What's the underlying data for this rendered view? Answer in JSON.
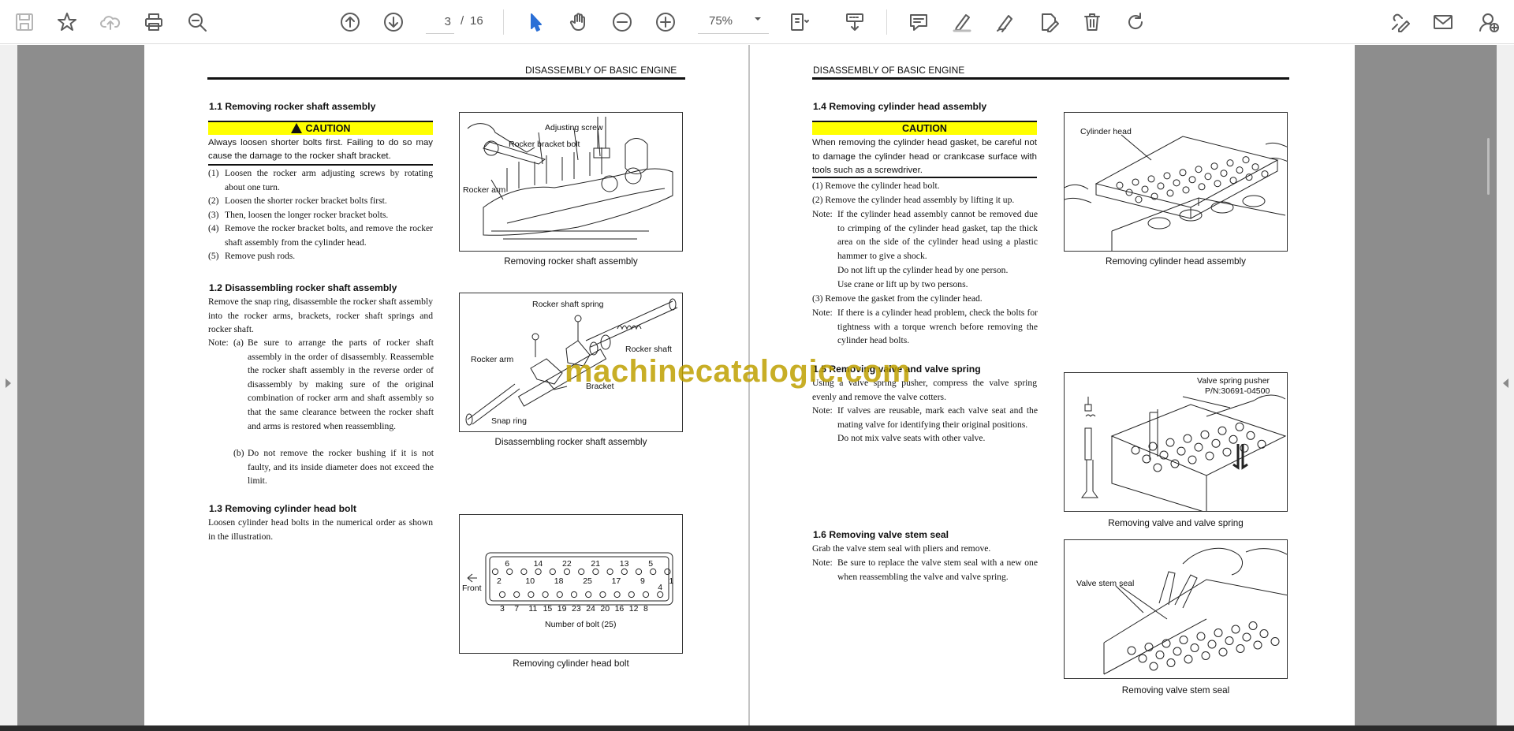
{
  "toolbar": {
    "page_current": "3",
    "page_sep": "/",
    "page_total": "16",
    "zoom": "75%"
  },
  "watermark": "machinecatalogic.com",
  "left_page": {
    "running_head": "DISASSEMBLY OF BASIC ENGINE",
    "s11": {
      "title": "1.1   Removing rocker shaft assembly",
      "caution": "CAUTION",
      "caution_text": "Always loosen shorter bolts first. Failing to do so may cause the damage to the rocker shaft bracket.",
      "steps": [
        {
          "n": "(1)",
          "t": "Loosen the rocker arm adjusting screws by rotating about one turn."
        },
        {
          "n": "(2)",
          "t": "Loosen the shorter rocker bracket bolts first."
        },
        {
          "n": "(3)",
          "t": "Then, loosen the longer rocker bracket bolts."
        },
        {
          "n": "(4)",
          "t": "Remove the rocker bracket bolts, and remove the rocker shaft assembly from the cylinder head."
        },
        {
          "n": "(5)",
          "t": "Remove push rods."
        }
      ],
      "fig_labels": {
        "a": "Adjusting screw",
        "b": "Rocker bracket bolt",
        "c": "Rocker arm"
      },
      "caption": "Removing rocker shaft assembly"
    },
    "s12": {
      "title": "1.2   Disassembling rocker shaft assembly",
      "text": "Remove the snap ring, disassemble the rocker shaft assembly into the rocker arms, brackets, rocker shaft springs and rocker shaft.",
      "note_label": "Note:",
      "note_a_label": "(a)",
      "note_a": "Be sure to arrange the parts of rocker shaft assembly in the order of disassembly. Reassemble the rocker shaft assembly in the reverse order of disassembly by making sure of the original combination of rocker arm and shaft assembly so that the same clearance between the rocker shaft and arms is restored when reassembling.",
      "note_b_label": "(b)",
      "note_b": "Do not remove the rocker bushing if it is not faulty, and its inside diameter does not exceed the limit.",
      "fig_labels": {
        "a": "Rocker shaft spring",
        "b": "Rocker shaft",
        "c": "Rocker arm",
        "d": "Bracket",
        "e": "Snap ring"
      },
      "caption": "Disassembling rocker shaft assembly"
    },
    "s13": {
      "title": "1.3   Removing cylinder head bolt",
      "text": "Loosen cylinder head bolts in the numerical order as shown in the illustration.",
      "front": "Front",
      "top_nums": [
        "2",
        "6",
        "10",
        "14",
        "18",
        "22",
        "25",
        "21",
        "17",
        "13",
        "9",
        "5",
        "1"
      ],
      "bot_nums": [
        "3",
        "7",
        "11",
        "15",
        "19",
        "23",
        "24",
        "20",
        "16",
        "12",
        "8",
        "4"
      ],
      "fig_note": "Number of bolt (25)",
      "caption": "Removing cylinder head bolt"
    }
  },
  "right_page": {
    "running_head": "DISASSEMBLY OF BASIC ENGINE",
    "s14": {
      "title": "1.4   Removing cylinder head assembly",
      "caution": "CAUTION",
      "caution_text": "When removing the cylinder head gasket, be careful not to damage the cylinder head or crankcase surface with tools such as a screwdriver.",
      "step1": "(1)  Remove the cylinder head bolt.",
      "step2": "(2)  Remove the cylinder head assembly by lifting it up.",
      "note1_label": "Note:",
      "note1": "If the cylinder head assembly cannot be removed due to crimping of the cylinder head gasket, tap the thick area on the side of the cylinder head using a plastic hammer to give a shock.",
      "note1b": "Do not lift up the cylinder head by one person.",
      "note1c": "Use crane or lift up by two persons.",
      "step3": "(3)  Remove the gasket from the cylinder head.",
      "note2_label": "Note:",
      "note2": "If there is a cylinder head problem, check the bolts for tightness with a torque wrench before removing the cylinder head bolts.",
      "fig_label": "Cylinder head",
      "caption": "Removing cylinder head assembly"
    },
    "s15": {
      "title": "1.5   Removing valve and valve spring",
      "text": "Using a valve spring pusher, compress the valve spring evenly and remove the valve cotters.",
      "note_label": "Note:",
      "note": "If valves are reusable, mark each valve seat and the mating valve for identifying their original positions.",
      "note_b": "Do not mix valve seats with other valve.",
      "fig_label1": "Valve spring pusher",
      "fig_label2": "P/N:30691-04500",
      "caption": "Removing valve and valve spring"
    },
    "s16": {
      "title": "1.6   Removing valve stem seal",
      "text": "Grab the valve stem seal with pliers and remove.",
      "note_label": "Note:",
      "note": "Be sure to replace the valve stem seal with a new one when reassembling the valve and valve spring.",
      "fig_label": "Valve stem seal",
      "caption": "Removing valve stem seal"
    }
  }
}
